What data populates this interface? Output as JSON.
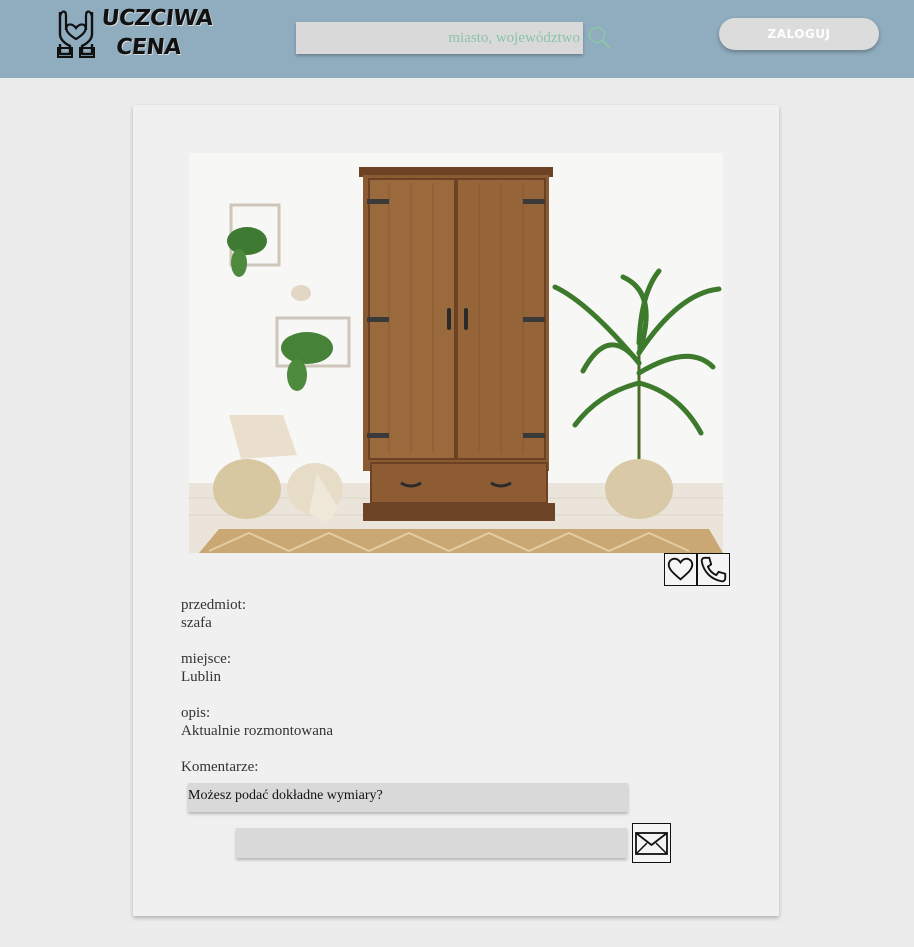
{
  "header": {
    "logo_line1": "UCZCIWA",
    "logo_line2": "CENA",
    "search_placeholder": "miasto, województwo",
    "login_label": "ZALOGUJ"
  },
  "listing": {
    "item_label": "przedmiot:",
    "item_value": "szafa",
    "place_label": "miejsce:",
    "place_value": "Lublin",
    "desc_label": "opis:",
    "desc_value": "Aktualnie rozmontowana",
    "comments_label": "Komentarze:",
    "comments": [
      "Możesz podać dokładne wymiary?"
    ]
  },
  "icons": {
    "logo": "hands-heart-icon",
    "search": "search-icon",
    "favorite": "heart-icon",
    "call": "phone-icon",
    "send": "envelope-icon"
  },
  "colors": {
    "header_bg": "#8fadbf",
    "page_bg": "#ececec",
    "card_bg": "#f0f0f0",
    "search_text": "#8cc4a8"
  }
}
